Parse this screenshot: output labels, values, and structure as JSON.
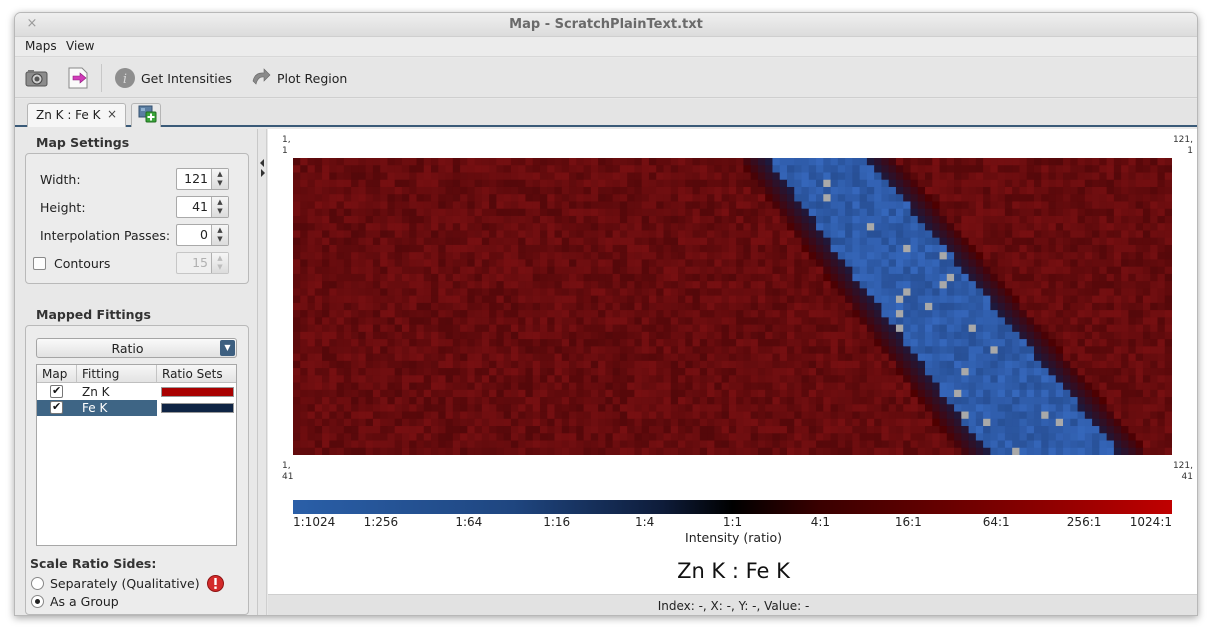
{
  "window": {
    "title": "Map - ScratchPlainText.txt",
    "close_glyph": "×"
  },
  "menu": {
    "items": [
      "Maps",
      "View"
    ]
  },
  "toolbar": {
    "get_intensities": "Get Intensities",
    "plot_region": "Plot Region"
  },
  "tabs": [
    {
      "label": "Zn K : Fe K",
      "close": "×"
    }
  ],
  "map_settings": {
    "title": "Map Settings",
    "width_label": "Width:",
    "width_value": "121",
    "height_label": "Height:",
    "height_value": "41",
    "interp_label": "Interpolation Passes:",
    "interp_value": "0",
    "contours_label": "Contours",
    "contours_value": "15",
    "contours_checked": false
  },
  "mapped_fittings": {
    "title": "Mapped Fittings",
    "mode": "Ratio",
    "columns": [
      "Map",
      "Fitting",
      "Ratio Sets"
    ],
    "rows": [
      {
        "name": "Zn K",
        "checked": true,
        "color": "#a80000",
        "selected": false
      },
      {
        "name": "Fe K",
        "checked": true,
        "color": "#0f2444",
        "selected": true
      }
    ]
  },
  "scale_ratio": {
    "title": "Scale Ratio Sides:",
    "option_separately": "Separately (Qualitative)",
    "option_group": "As a Group",
    "selected": "As a Group"
  },
  "map": {
    "corner_tl": "1,\n1",
    "corner_tr": "121,\n1",
    "corner_bl": "1,\n41",
    "corner_br": "121,\n41",
    "title": "Zn K : Fe K",
    "colorbar_ticks": [
      "1:1024",
      "1:256",
      "1:64",
      "1:16",
      "1:4",
      "1:1",
      "4:1",
      "16:1",
      "64:1",
      "256:1",
      "1024:1"
    ],
    "axis_title": "Intensity (ratio)",
    "grid_cols": 121,
    "grid_rows": 41
  },
  "status": {
    "text": "Index: -, X: -, Y: -, Value: -"
  }
}
